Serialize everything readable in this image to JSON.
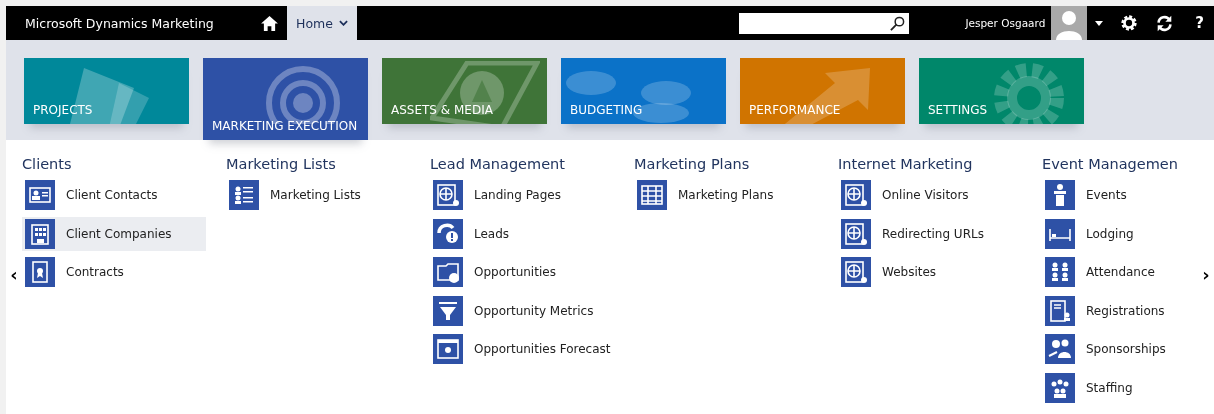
{
  "topbar": {
    "title": "Microsoft Dynamics Marketing",
    "home_tab": {
      "label": "Home",
      "selected": true
    },
    "user": "Jesper Osgaard",
    "help": "?"
  },
  "tiles": [
    {
      "label": "PROJECTS",
      "color": "#00889a",
      "selected": false
    },
    {
      "label": "MARKETING EXECUTION",
      "color": "#2e51a6",
      "selected": true
    },
    {
      "label": "ASSETS & MEDIA",
      "color": "#3f7438",
      "selected": false
    },
    {
      "label": "BUDGETING",
      "color": "#0b72c8",
      "selected": false
    },
    {
      "label": "PERFORMANCE",
      "color": "#d07400",
      "selected": false
    },
    {
      "label": "SETTINGS",
      "color": "#00876a",
      "selected": false
    }
  ],
  "nav": {
    "prev": "‹",
    "next": "›"
  },
  "groups": [
    {
      "title": "Clients",
      "items": [
        {
          "label": "Client Contacts",
          "selected": false
        },
        {
          "label": "Client Companies",
          "selected": true
        },
        {
          "label": "Contracts",
          "selected": false
        }
      ]
    },
    {
      "title": "Marketing Lists",
      "items": [
        {
          "label": "Marketing Lists",
          "selected": false
        }
      ]
    },
    {
      "title": "Lead Management",
      "items": [
        {
          "label": "Landing Pages",
          "selected": false
        },
        {
          "label": "Leads",
          "selected": false
        },
        {
          "label": "Opportunities",
          "selected": false
        },
        {
          "label": "Opportunity Metrics",
          "selected": false
        },
        {
          "label": "Opportunities Forecast",
          "selected": false
        }
      ]
    },
    {
      "title": "Marketing Plans",
      "items": [
        {
          "label": "Marketing Plans",
          "selected": false
        }
      ]
    },
    {
      "title": "Internet Marketing",
      "items": [
        {
          "label": "Online Visitors",
          "selected": false
        },
        {
          "label": "Redirecting URLs",
          "selected": false
        },
        {
          "label": "Websites",
          "selected": false
        }
      ]
    },
    {
      "title": "Event Managemen",
      "items": [
        {
          "label": "Events",
          "selected": false
        },
        {
          "label": "Lodging",
          "selected": false
        },
        {
          "label": "Attendance",
          "selected": false
        },
        {
          "label": "Registrations",
          "selected": false
        },
        {
          "label": "Sponsorships",
          "selected": false
        },
        {
          "label": "Staffing",
          "selected": false
        }
      ]
    }
  ]
}
